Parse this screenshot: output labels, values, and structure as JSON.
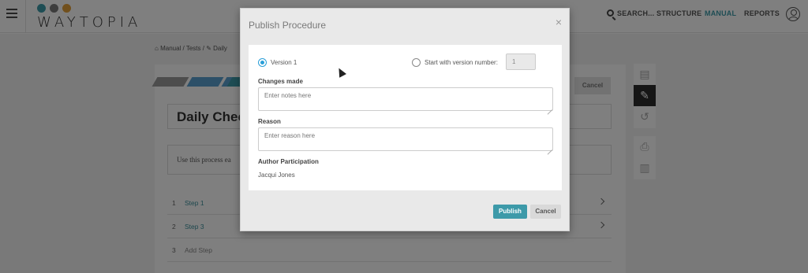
{
  "header": {
    "logo_text": "WAYTOPIA",
    "logo_dot_colors": [
      "#3d9aa9",
      "#7a7a7a",
      "#e3a03a"
    ],
    "search_label": "SEARCH...",
    "nav": [
      "STRUCTURE",
      "MANUAL",
      "REPORTS"
    ],
    "active_nav": "MANUAL",
    "accent": "#3d9aa9"
  },
  "background": {
    "breadcrumb": [
      "Manual /",
      "Tests /",
      "Daily"
    ],
    "stripe_colors": [
      "#9a9a9a",
      "#5aa0d0",
      "#5aa0d0",
      "#3d9aa9"
    ],
    "cancel_label": "Cancel",
    "title": "Daily Chec",
    "description": "Use this process ea",
    "steps": [
      {
        "num": "1",
        "label": "Step 1"
      },
      {
        "num": "2",
        "label": "Step 3"
      },
      {
        "num": "3",
        "label": "Add Step"
      }
    ]
  },
  "modal": {
    "title": "Publish Procedure",
    "close_glyph": "×",
    "version_option": "Version 1",
    "start_with_label": "Start with version number:",
    "start_with_value": "1",
    "changes_label": "Changes made",
    "changes_placeholder": "Enter notes here",
    "reason_label": "Reason",
    "reason_placeholder": "Enter reason here",
    "author_label": "Author Participation",
    "author_value": "Jacqui Jones",
    "publish_label": "Publish",
    "cancel_label": "Cancel"
  }
}
